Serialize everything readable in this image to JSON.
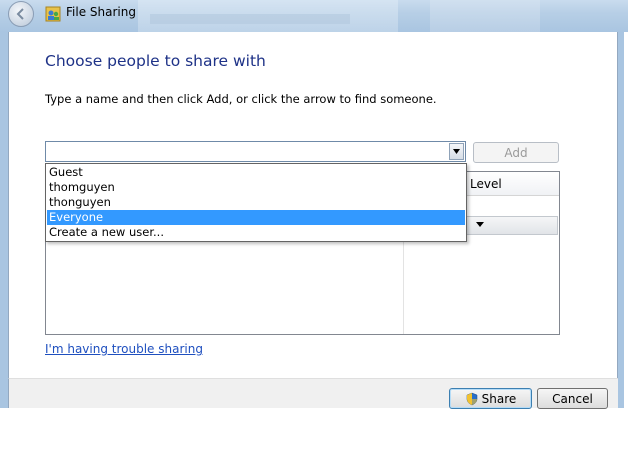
{
  "window": {
    "title": "File Sharing"
  },
  "main": {
    "heading": "Choose people to share with",
    "instruction": "Type a name and then click Add, or click the arrow to find someone.",
    "name_input_value": "",
    "add_label": "Add",
    "list_column_level": "Level",
    "dropdown_options": [
      "Guest",
      "thomguyen",
      "thonguyen",
      "Everyone",
      "Create a new user..."
    ],
    "dropdown_selected": "Everyone",
    "trouble_link": "I'm having trouble sharing"
  },
  "footer": {
    "share_label": "Share",
    "cancel_label": "Cancel"
  },
  "colors": {
    "heading": "#1e3287",
    "selection": "#3399ff",
    "link": "#1e4fbf"
  }
}
